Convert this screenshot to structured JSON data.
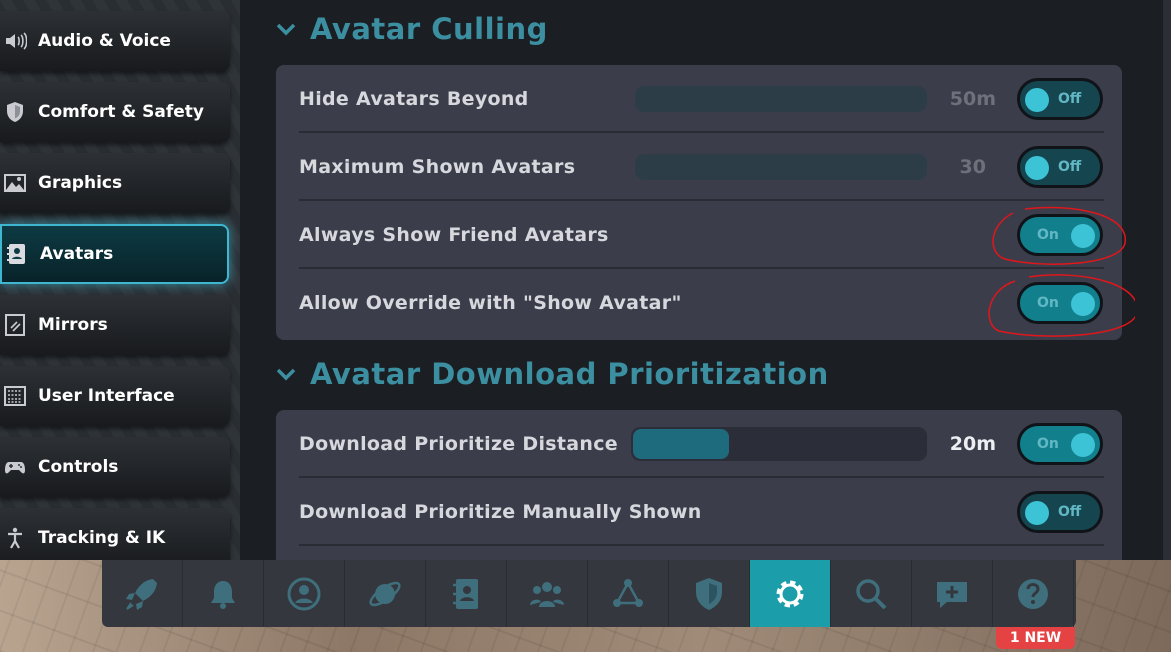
{
  "sidebar": {
    "items": [
      {
        "label": "Audio & Voice",
        "icon": "speaker-icon"
      },
      {
        "label": "Comfort & Safety",
        "icon": "shield-icon"
      },
      {
        "label": "Graphics",
        "icon": "image-icon"
      },
      {
        "label": "Avatars",
        "icon": "avatar-book-icon",
        "active": true
      },
      {
        "label": "Mirrors",
        "icon": "mirror-icon"
      },
      {
        "label": "User Interface",
        "icon": "keyboard-icon"
      },
      {
        "label": "Controls",
        "icon": "gamepad-icon"
      },
      {
        "label": "Tracking & IK",
        "icon": "person-icon"
      }
    ]
  },
  "sections": [
    {
      "title": "Avatar Culling",
      "rows": [
        {
          "label": "Hide Avatars Beyond",
          "slider_value": "50m",
          "slider_fill": 0,
          "slider_disabled": true,
          "toggle": "Off"
        },
        {
          "label": "Maximum Shown Avatars",
          "slider_value": "30",
          "slider_fill": 0,
          "slider_disabled": true,
          "toggle": "Off"
        },
        {
          "label": "Always Show Friend Avatars",
          "toggle": "On",
          "annotated": true
        },
        {
          "label": "Allow Override with \"Show Avatar\"",
          "toggle": "On",
          "annotated": true
        }
      ]
    },
    {
      "title": "Avatar Download Prioritization",
      "rows": [
        {
          "label": "Download Prioritize Distance",
          "slider_value": "20m",
          "slider_fill": 0.33,
          "slider_disabled": false,
          "toggle": "On"
        },
        {
          "label": "Download Prioritize Manually Shown",
          "toggle": "Off"
        }
      ]
    }
  ],
  "dock": {
    "items": [
      {
        "icon": "rocket-icon"
      },
      {
        "icon": "bell-icon"
      },
      {
        "icon": "profile-icon"
      },
      {
        "icon": "planet-icon"
      },
      {
        "icon": "avatar-book-icon"
      },
      {
        "icon": "people-icon"
      },
      {
        "icon": "network-icon"
      },
      {
        "icon": "shield-icon"
      },
      {
        "icon": "gear-icon",
        "active": true
      },
      {
        "icon": "search-icon"
      },
      {
        "icon": "chat-plus-icon"
      },
      {
        "icon": "help-icon"
      }
    ],
    "badge": "1 NEW"
  },
  "colors": {
    "accent": "#3b8fa0",
    "toggle_on": "#127f8d",
    "annotation": "#e0161b",
    "badge": "#e44243"
  }
}
